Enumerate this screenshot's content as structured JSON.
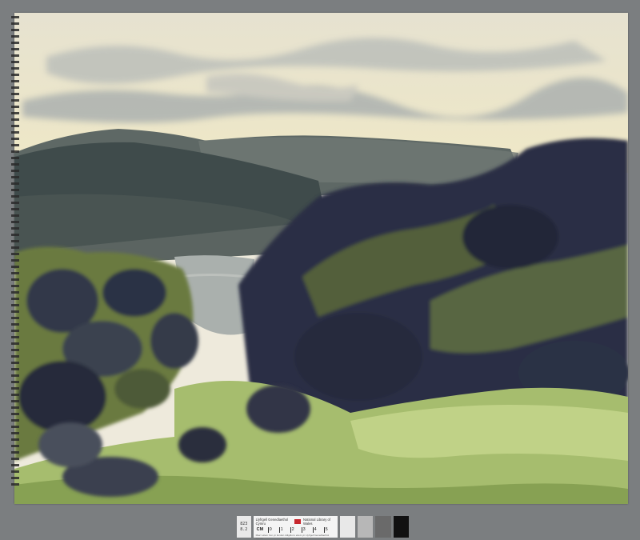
{
  "image": {
    "subject": "watercolour-landscape-sketch",
    "palette": {
      "sky": "#ece7cf",
      "cloud": "#aab1b0",
      "far_hills": "#56615e",
      "mid_hills": "#3f4a4a",
      "lake": "#a9aeaa",
      "dark_foliage": "#2c3144",
      "olive_foliage": "#6d7a3e",
      "meadow": "#a9c071"
    }
  },
  "target": {
    "id_top": "823",
    "id_bottom": "8.2",
    "institution_welsh": "Llyfrgell Genedlaethol Cymru",
    "institution_english": "National Library of Wales",
    "scale_unit": "CM",
    "scale_marks": [
      "0",
      "1",
      "2",
      "3",
      "4",
      "5"
    ],
    "footnote": "Mae'r eitem hon yn fersiwn ddigidol o eitem yn Llyfrgell Genedlaethol Cymru",
    "patches": [
      "#e8e8e8",
      "#b7b7b7",
      "#6a6a6a",
      "#111111"
    ]
  }
}
